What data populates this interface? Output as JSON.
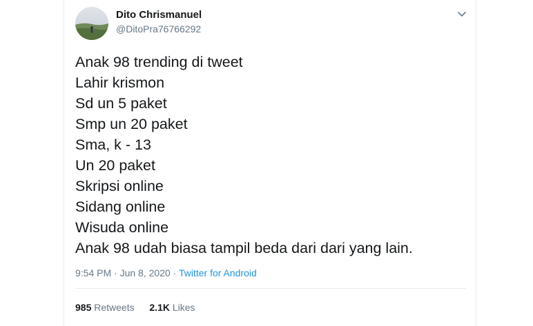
{
  "author": {
    "name": "Dito Chrismanuel",
    "handle": "@DitoPra76766292"
  },
  "tweet": {
    "lines": [
      "Anak 98 trending di tweet",
      "Lahir krismon",
      "Sd un 5 paket",
      "Smp un 20 paket",
      "Sma, k - 13",
      "Un 20 paket",
      "Skripsi online",
      "Sidang online",
      "Wisuda online",
      "Anak 98 udah biasa tampil beda dari dari yang lain."
    ]
  },
  "meta": {
    "time": "9:54 PM",
    "separator": "·",
    "date": "Jun 8, 2020",
    "source": "Twitter for Android"
  },
  "stats": {
    "retweets_count": "985",
    "retweets_label": "Retweets",
    "likes_count": "2.1K",
    "likes_label": "Likes"
  },
  "icons": {
    "menu": "chevron-down-icon",
    "avatar": "profile-photo"
  },
  "colors": {
    "text": "#14171a",
    "secondary": "#657786",
    "link": "#1b95e0",
    "border": "#e6ecf0"
  }
}
